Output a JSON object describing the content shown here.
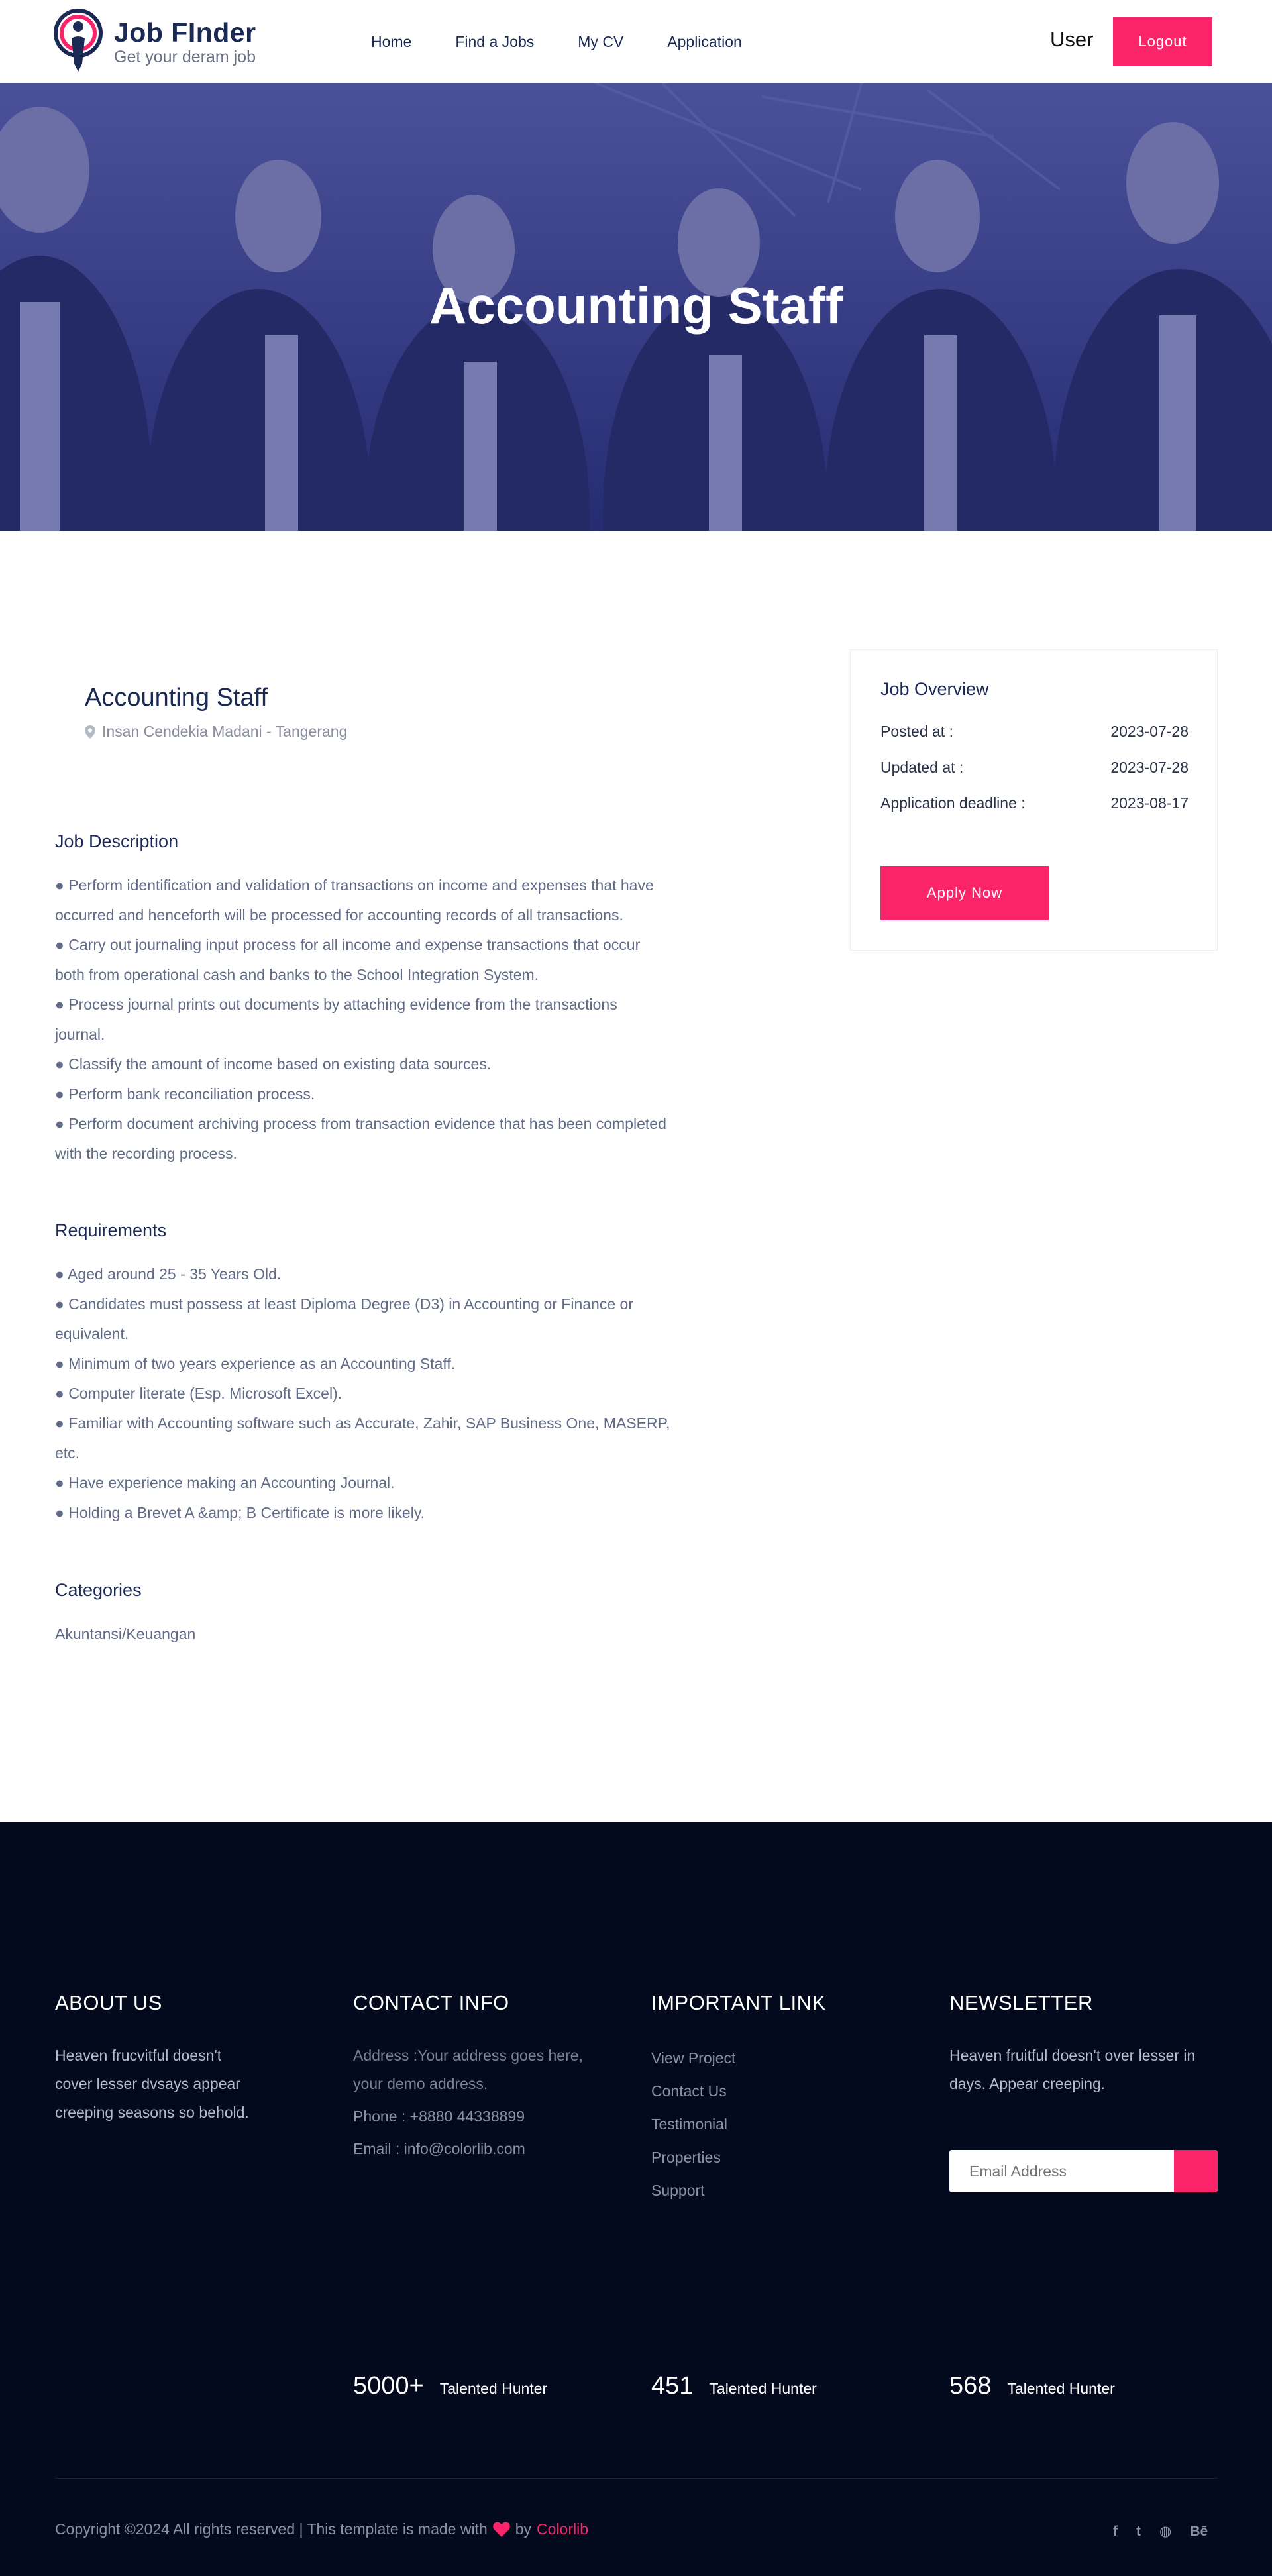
{
  "brand": {
    "title": "Job FInder",
    "tagline": "Get your deram job",
    "accent": "#fb246a",
    "navy": "#1b2a55",
    "footer_bg": "#030a1e"
  },
  "nav": {
    "items": [
      {
        "label": "Home"
      },
      {
        "label": "Find a Jobs"
      },
      {
        "label": "My CV"
      },
      {
        "label": "Application"
      }
    ],
    "user_label": "User",
    "logout_label": "Logout"
  },
  "hero": {
    "title": "Accounting Staff"
  },
  "job": {
    "title": "Accounting Staff",
    "location": "Insan Cendekia Madani - Tangerang",
    "location_icon": "map-pin-icon"
  },
  "description": {
    "heading": "Job Description",
    "lines": [
      "● Perform identification and validation of transactions on income and expenses that have",
      "occurred and henceforth will be processed for accounting records of all transactions.",
      "● Carry out journaling input process for all income and expense transactions that occur",
      "both from operational cash and banks to the School Integration System.",
      "● Process journal prints out documents by attaching evidence from the transactions",
      "journal.",
      "● Classify the amount of income based on existing data sources.",
      "● Perform bank reconciliation process.",
      "● Perform document archiving process from transaction evidence that has been completed",
      "with the recording process."
    ]
  },
  "requirements": {
    "heading": "Requirements",
    "lines": [
      "● Aged around 25 - 35 Years Old.",
      "● Candidates must possess at least Diploma Degree (D3) in Accounting or Finance or",
      "equivalent.",
      "● Minimum of two years experience as an Accounting Staff.",
      "● Computer literate (Esp. Microsoft Excel).",
      "● Familiar with Accounting software such as Accurate, Zahir, SAP Business One, MASERP,",
      "etc.",
      "● Have experience making an Accounting Journal.",
      "● Holding a Brevet A &amp; B Certificate is more likely."
    ]
  },
  "categories": {
    "heading": "Categories",
    "value": "Akuntansi/Keuangan"
  },
  "overview": {
    "title": "Job Overview",
    "rows": [
      {
        "label": "Posted at :",
        "value": "2023-07-28"
      },
      {
        "label": "Updated at :",
        "value": "2023-07-28"
      },
      {
        "label": "Application deadline :",
        "value": "2023-08-17"
      }
    ],
    "apply_label": "Apply Now"
  },
  "footer": {
    "about": {
      "heading": "ABOUT US",
      "lines": [
        "Heaven frucvitful doesn't",
        "cover lesser dvsays appear",
        "creeping seasons so behold."
      ]
    },
    "contact": {
      "heading": "CONTACT INFO",
      "address_lines": [
        "Address :Your address goes here,",
        "your demo address."
      ],
      "phone": "Phone : +8880 44338899",
      "email": "Email : info@colorlib.com"
    },
    "links": {
      "heading": "IMPORTANT LINK",
      "items": [
        "View Project",
        "Contact Us",
        "Testimonial",
        "Properties",
        "Support"
      ]
    },
    "newsletter": {
      "heading": "NEWSLETTER",
      "lines": [
        "Heaven fruitful doesn't over lesser in",
        "days. Appear creeping."
      ],
      "placeholder": "Email Address"
    },
    "stats": [
      {
        "number": "5000+",
        "label": "Talented Hunter"
      },
      {
        "number": "451",
        "label": "Talented Hunter"
      },
      {
        "number": "568",
        "label": "Talented Hunter"
      }
    ],
    "copyright_prefix": "Copyright ©2024 All rights reserved | This template is made with",
    "copyright_by": "by",
    "copyright_brand": "Colorlib",
    "socials": [
      {
        "icon": "facebook-icon",
        "glyph": "f"
      },
      {
        "icon": "twitter-icon",
        "glyph": "t"
      },
      {
        "icon": "globe-icon",
        "glyph": "◍"
      },
      {
        "icon": "behance-icon",
        "glyph": "Bē"
      }
    ]
  }
}
